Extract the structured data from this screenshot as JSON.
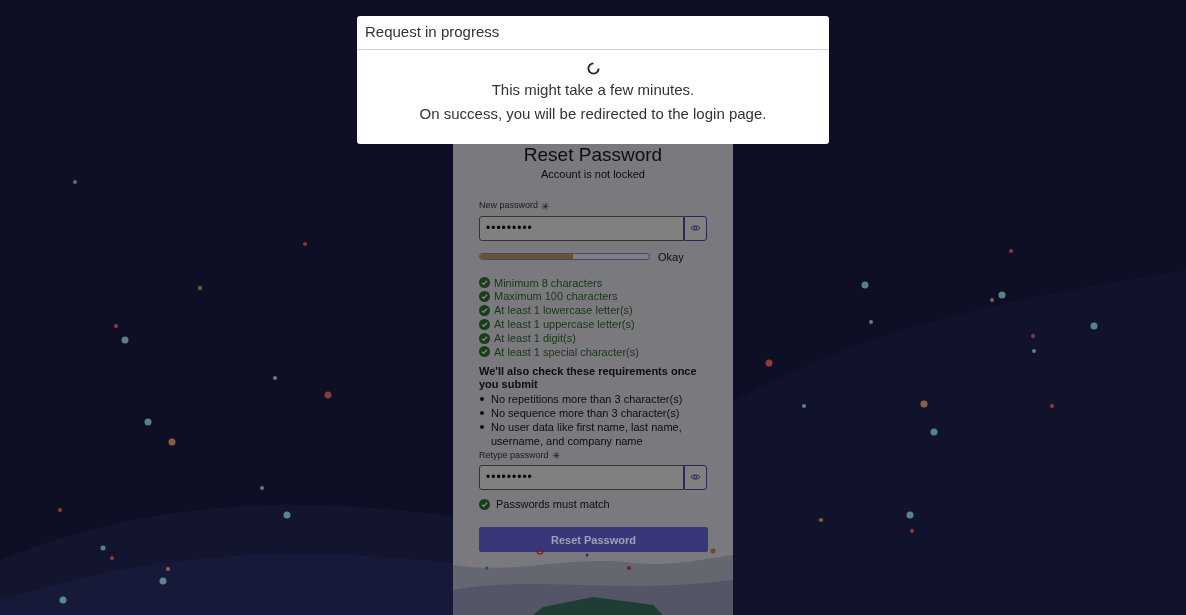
{
  "dialog": {
    "title": "Request in progress",
    "messages": [
      "This might take a few minutes.",
      "On success, you will be redirected to the login page."
    ]
  },
  "card": {
    "title": "Reset Password",
    "account_status": "Account is not locked",
    "new_password": {
      "label": "New password",
      "required_mark": "✳",
      "value": "•••••••••",
      "strength": {
        "level": 0.55,
        "label": "Okay"
      }
    },
    "requirements": [
      {
        "text": "Minimum 8 characters",
        "met": true
      },
      {
        "text": "Maximum 100 characters",
        "met": true
      },
      {
        "text": "At least 1 lowercase letter(s)",
        "met": true
      },
      {
        "text": "At least 1 uppercase letter(s)",
        "met": true
      },
      {
        "text": "At least 1 digit(s)",
        "met": true
      },
      {
        "text": "At least 1 special character(s)",
        "met": true
      }
    ],
    "submit_note": "We'll also check these requirements once you submit",
    "submit_rules": [
      "No repetitions more than 3 character(s)",
      "No sequence more than 3 character(s)",
      "No user data like first name, last name, username, and company name"
    ],
    "retype_password": {
      "label": "Retype password",
      "required_mark": "✳",
      "value": "•••••••••"
    },
    "match": {
      "text": "Passwords must match",
      "met": true
    },
    "button": "Reset Password"
  }
}
